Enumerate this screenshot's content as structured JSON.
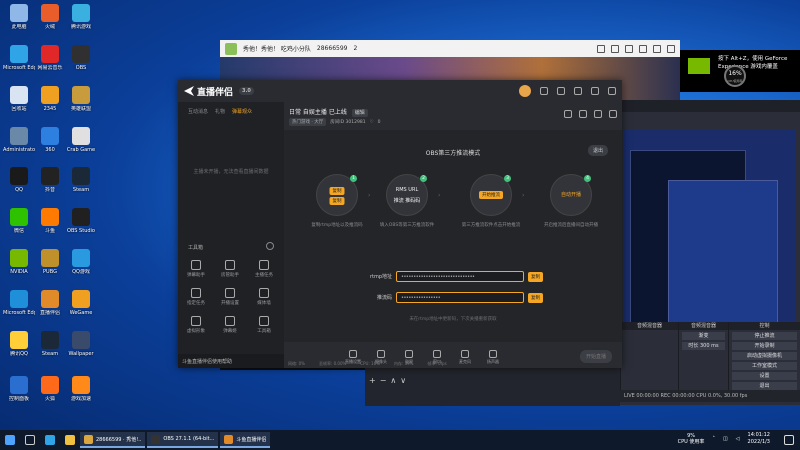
{
  "desktop": {
    "icons": [
      {
        "label": "此电脑",
        "color": "#8fb8e8"
      },
      {
        "label": "Microsoft Edge",
        "color": "#2fa4e7"
      },
      {
        "label": "回收站",
        "color": "#d8e4f2"
      },
      {
        "label": "Administrator",
        "color": "#6a88a8"
      },
      {
        "label": "QQ",
        "color": "#1a1a1a"
      },
      {
        "label": "微信",
        "color": "#2dc100"
      },
      {
        "label": "NVIDIA",
        "color": "#76b900"
      },
      {
        "label": "Microsoft Edge",
        "color": "#1e8fd8"
      },
      {
        "label": "腾讯QQ",
        "color": "#ffcf3a"
      },
      {
        "label": "控制面板",
        "color": "#2a6fcf"
      },
      {
        "label": "火绒",
        "color": "#e85d2a"
      },
      {
        "label": "网易云音乐",
        "color": "#e02828"
      },
      {
        "label": "2345",
        "color": "#f0a020"
      },
      {
        "label": "360",
        "color": "#2d7fe0"
      },
      {
        "label": "抖音",
        "color": "#222"
      },
      {
        "label": "斗鱼",
        "color": "#ff7a00"
      },
      {
        "label": "PUBG",
        "color": "#c0902a"
      },
      {
        "label": "直播伴侣",
        "color": "#e08a2a"
      },
      {
        "label": "Steam",
        "color": "#1b2838"
      },
      {
        "label": "火狐",
        "color": "#ff6a1a"
      },
      {
        "label": "腾讯游戏",
        "color": "#3ab0e0"
      },
      {
        "label": "OBS",
        "color": "#303030"
      },
      {
        "label": "英雄联盟",
        "color": "#c89b3c"
      },
      {
        "label": "Crab Game",
        "color": "#e0e0e0"
      },
      {
        "label": "Steam",
        "color": "#1b2838"
      },
      {
        "label": "OBS Studio",
        "color": "#202020"
      },
      {
        "label": "QQ游戏",
        "color": "#2a9ae0"
      },
      {
        "label": "WeGame",
        "color": "#f0a020"
      },
      {
        "label": "Wallpaper",
        "color": "#3a4a6a"
      },
      {
        "label": "游戏加速",
        "color": "#ff8a1a"
      }
    ]
  },
  "game_window": {
    "title": "秀他！秀他！ 吃鸡小分队 ",
    "room": "28666599",
    "count": "2"
  },
  "nvidia_toast": {
    "line1": "按下 Alt+Z，使用 GeForce",
    "line2": "Experience 游戏内覆盖"
  },
  "gauge": {
    "value": "16%",
    "sub": "CPU使用率"
  },
  "app": {
    "logo": "直播伴侣",
    "version": "3.0",
    "side_tabs": [
      "互动消息",
      "礼物",
      "弹幕观众"
    ],
    "side_empty": "主播未开播，无法查看直播间数据",
    "tools_title": "工具箱",
    "tools": [
      "弹幕助手",
      "房管助手",
      "主播任务",
      "指定任务",
      "开播设置",
      "媒体墙",
      "虚拟形象",
      "弹幕姬",
      "工具箱"
    ],
    "side_footer": "斗鱼直播伴侣使用帮助",
    "stream_title": "日常 自娱主播 已上线",
    "stream_tag": "编辑",
    "category": "热门游戏 · 大厅",
    "room_id": "房间ID 3012981",
    "fans": "0",
    "mode_title": "OBS第三方推流模式",
    "exit_label": "退出",
    "steps": [
      {
        "num": "1",
        "pill1": "复制",
        "pill2": "复制",
        "desc": "复制rtmp地址以及推流码"
      },
      {
        "num": "2",
        "text1": "RMS URL",
        "text2": "推流 推码码",
        "desc": "填入OBS等第三方推流软件"
      },
      {
        "num": "3",
        "pill1": "开始推流",
        "desc": "第三方推流软件点击开始推流"
      },
      {
        "num": "4",
        "text1": "自动开播",
        "desc": "开启推流后直播间自动开播"
      }
    ],
    "rtmp_label": "rtmp地址",
    "rtmp_value": "••••••••••••••••••••••••••••••",
    "rtmp_btn": "复制",
    "key_label": "推流码",
    "key_value": "••••••••••••••••",
    "key_btn": "复制",
    "hint": "未在rtmp地址中更新码，下次关播重新获取",
    "toolbar": [
      "直播设置",
      "摄像头",
      "副屏",
      "窗口",
      "麦克风",
      "扬声器"
    ],
    "start_live": "开始直播",
    "perf": [
      "网络: 0%",
      "丢帧率: 0.00%",
      "CPU: 16%",
      "内存: 39%",
      "帧率: 0fps"
    ]
  },
  "obs": {
    "mixer_head": "音频混音器",
    "controls_head": "控制",
    "controls": [
      "停止推流",
      "开始录制",
      "启动虚拟摄像机",
      "工作室模式",
      "设置",
      "退出"
    ],
    "transition": "渐变",
    "duration": "时长 300 ms",
    "status": "LIVE 00:00:00   REC 00:00:00   CPU 0.0%, 30.00 fps"
  },
  "taskbar": {
    "tasks": [
      {
        "label": "28666599 · 秀他!..",
        "color": "#d9a640"
      },
      {
        "label": "OBS 27.1.1 (64-bit...",
        "color": "#333"
      },
      {
        "label": "斗鱼直播伴侣",
        "color": "#e08a2a"
      }
    ],
    "cpu_value": "9%",
    "cpu_label": "CPU 使用率",
    "time": "14:01:12",
    "date": "2022/1/3"
  }
}
